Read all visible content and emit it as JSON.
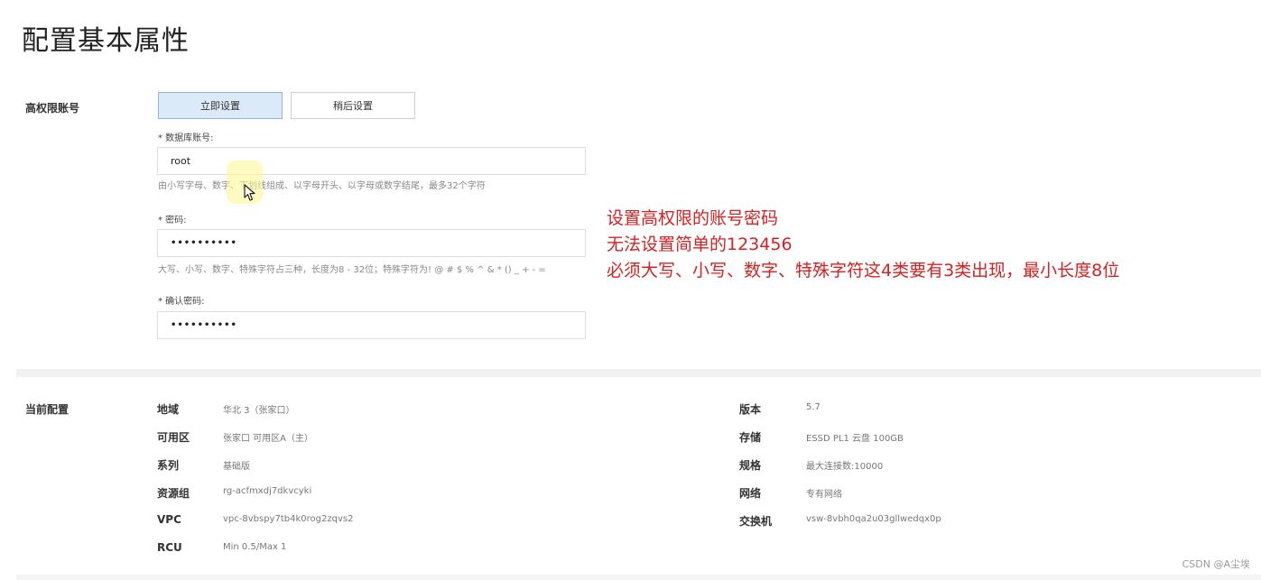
{
  "page": {
    "title": "配置基本属性"
  },
  "account": {
    "section_label": "高权限账号",
    "set_now_label": "立即设置",
    "set_later_label": "稍后设置",
    "db_account_label": "* 数据库账号:",
    "db_account_value": "root",
    "db_account_hint": "由小写字母、数字、下划线组成、以字母开头、以字母或数字结尾，最多32个字符",
    "password_label": "* 密码:",
    "password_value": "••••••••••",
    "password_hint": "大写、小写、数字、特殊字符占三种，长度为8 - 32位；特殊字符为! @ # $ % ^ & * () _ + - =",
    "confirm_label": "* 确认密码:",
    "confirm_value": "••••••••••"
  },
  "annotation": {
    "lines": [
      "设置高权限的账号密码",
      "无法设置简单的123456",
      "必须大写、小写、数字、特殊字符这4类要有3类出现，最小长度8位"
    ],
    "color": "#d42121"
  },
  "current_config": {
    "section_label": "当前配置",
    "left": [
      {
        "key": "地域",
        "value": "华北 3（张家口）"
      },
      {
        "key": "可用区",
        "value": "张家口 可用区A（主）"
      },
      {
        "key": "系列",
        "value": "基础版"
      },
      {
        "key": "资源组",
        "value": "rg-acfmxdj7dkvcyki"
      },
      {
        "key": "VPC",
        "value": "vpc-8vbspy7tb4k0rog2zqvs2"
      },
      {
        "key": "RCU",
        "value": "Min 0.5/Max 1"
      }
    ],
    "right": [
      {
        "key": "版本",
        "value": "5.7"
      },
      {
        "key": "存储",
        "value": "ESSD PL1 云盘 100GB"
      },
      {
        "key": "规格",
        "value": "最大连接数:10000"
      },
      {
        "key": "网络",
        "value": "专有网络"
      },
      {
        "key": "交换机",
        "value": "vsw-8vbh0qa2u03gllwedqx0p"
      }
    ]
  },
  "watermark": "CSDN @A尘埃",
  "colors": {
    "primary_button_bg": "#dce9f8",
    "primary_button_border": "#8fb3db",
    "annotation_red": "#d42121"
  }
}
